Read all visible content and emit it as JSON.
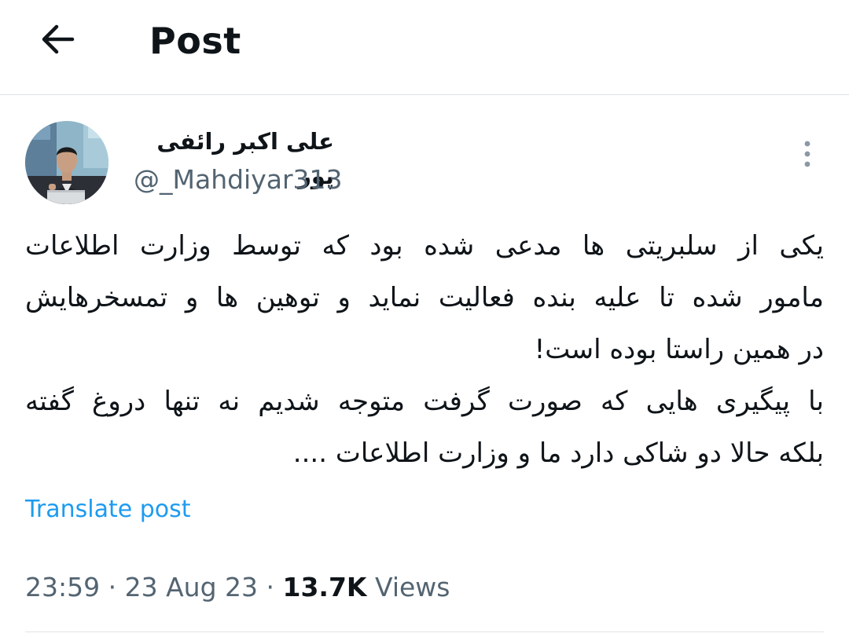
{
  "header": {
    "title": "Post",
    "back_icon": "arrow-left-icon"
  },
  "author": {
    "display_name": "علی اکبر رائفی پور",
    "handle": "@_Mahdiyar313",
    "avatar_icon": "user-avatar"
  },
  "post": {
    "lines": [
      "یکی از سلبریتی ها مدعی شده بود که توسط وزارت اطلاعات",
      "مامور شده تا علیه بنده فعالیت نماید و  توهین ها و تمسخرهایش",
      "در همین راستا بوده است!",
      "با پیگیری هایی که صورت گرفت متوجه شدیم نه تنها دروغ گفته",
      "بلکه حالا دو شاکی دارد ما و وزارت اطلاعات ...."
    ],
    "more_icon": "more-vertical-icon"
  },
  "translate": {
    "label": "Translate post"
  },
  "meta": {
    "time": "23:59",
    "separator": " · ",
    "date": "23 Aug 23",
    "views_count": "13.7K",
    "views_label": "Views"
  },
  "colors": {
    "text_primary": "#0f1419",
    "text_secondary": "#536471",
    "link": "#1d9bf0",
    "divider": "#dfe3e6"
  }
}
